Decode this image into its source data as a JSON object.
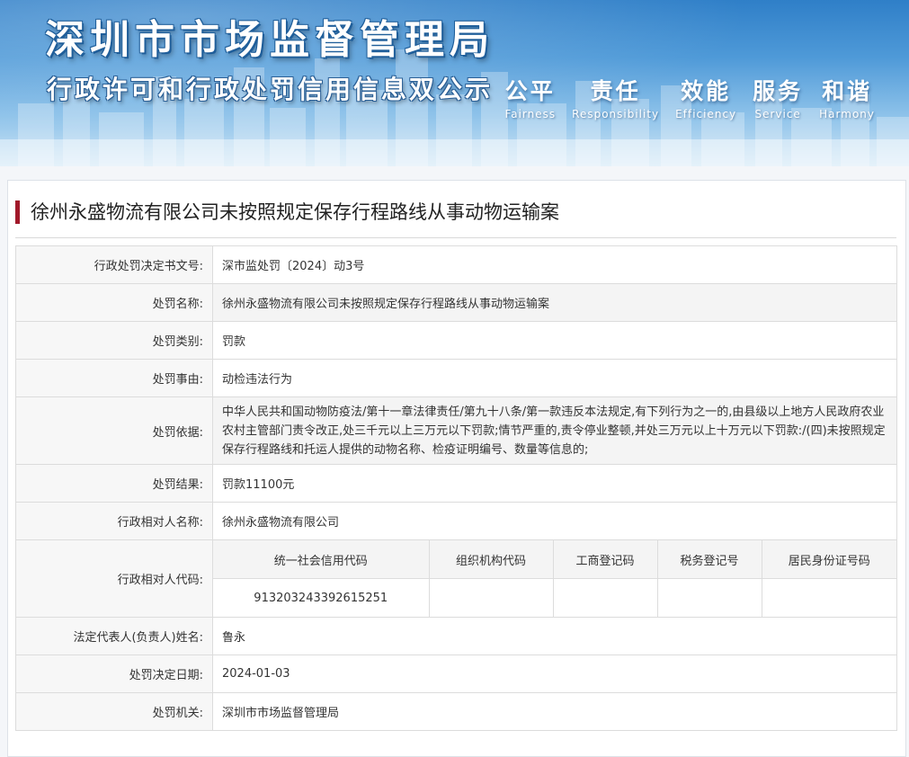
{
  "banner": {
    "title": "深圳市市场监督管理局",
    "subtitle": "行政许可和行政处罚信用信息双公示",
    "slogans": [
      {
        "cn": "公平",
        "en": "Fairness"
      },
      {
        "cn": "责任",
        "en": "Responsibility"
      },
      {
        "cn": "效能",
        "en": "Efficiency"
      },
      {
        "cn": "服务",
        "en": "Service"
      },
      {
        "cn": "和谐",
        "en": "Harmony"
      }
    ]
  },
  "case": {
    "title": "徐州永盛物流有限公司未按照规定保存行程路线从事动物运输案",
    "accent_color": "#a1192a"
  },
  "fields": {
    "doc_no": {
      "label": "行政处罚决定书文号:",
      "value": "深市监处罚〔2024〕动3号"
    },
    "name": {
      "label": "处罚名称:",
      "value": "徐州永盛物流有限公司未按照规定保存行程路线从事动物运输案"
    },
    "type": {
      "label": "处罚类别:",
      "value": "罚款"
    },
    "reason": {
      "label": "处罚事由:",
      "value": "动检违法行为"
    },
    "basis": {
      "label": "处罚依据:",
      "value": "中华人民共和国动物防疫法/第十一章法律责任/第九十八条/第一款违反本法规定,有下列行为之一的,由县级以上地方人民政府农业农村主管部门责令改正,处三千元以上三万元以下罚款;情节严重的,责令停业整顿,并处三万元以上十万元以下罚款:/(四)未按照规定保存行程路线和托运人提供的动物名称、检疫证明编号、数量等信息的;"
    },
    "result": {
      "label": "处罚结果:",
      "value": "罚款11100元"
    },
    "party_name": {
      "label": "行政相对人名称:",
      "value": "徐州永盛物流有限公司"
    },
    "party_code": {
      "label": "行政相对人代码:",
      "headers": [
        "统一社会信用代码",
        "组织机构代码",
        "工商登记码",
        "税务登记号",
        "居民身份证号码"
      ],
      "values": [
        "913203243392615251",
        "",
        "",
        "",
        ""
      ]
    },
    "legal_rep": {
      "label": "法定代表人(负责人)姓名:",
      "value": "鲁永"
    },
    "decision_date": {
      "label": "处罚决定日期:",
      "value": "2024-01-03"
    },
    "authority": {
      "label": "处罚机关:",
      "value": "深圳市市场监督管理局"
    }
  }
}
